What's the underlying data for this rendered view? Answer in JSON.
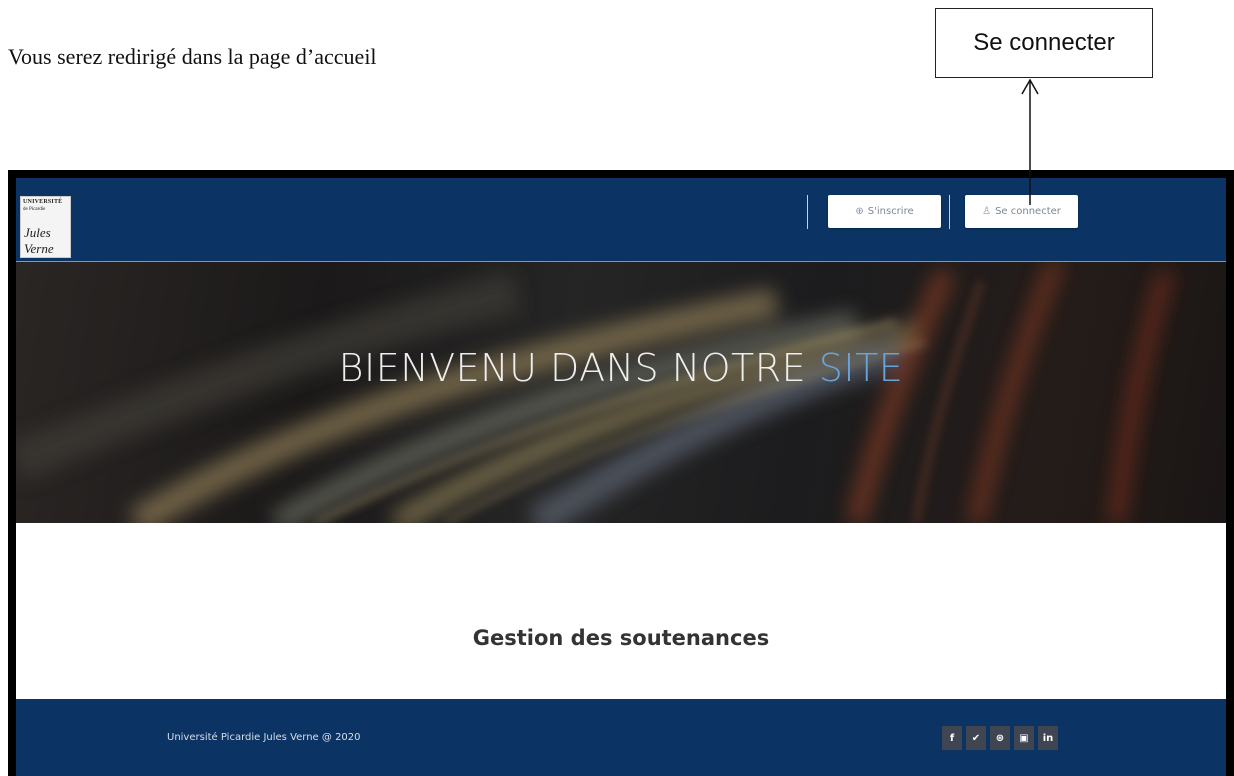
{
  "document": {
    "caption": "Vous serez redirigé dans la page d’accueil",
    "callout_label": "Se connecter"
  },
  "navbar": {
    "logo_text": "UNIVERSITÉ",
    "logo_subtext": "de Picardie",
    "logo_signature": "Jules Verne",
    "signup_label": "S'inscrire",
    "login_label": "Se connecter",
    "signup_icon": "user-plus-icon",
    "login_icon": "user-icon"
  },
  "hero": {
    "title_main": "BIENVENU DANS NOTRE ",
    "title_accent": "SITE"
  },
  "content": {
    "title": "Gestion des soutenances"
  },
  "footer": {
    "copyright": "Université Picardie Jules Verne @ 2020",
    "social": [
      "f",
      "✔",
      "⊛",
      "▣",
      "in"
    ],
    "social_icons": [
      "facebook-icon",
      "twitter-icon",
      "dribbble-icon",
      "flickr-icon",
      "linkedin-icon"
    ]
  },
  "colors": {
    "navbar": "#0b3464",
    "accent": "#6aa3d8",
    "footer": "#0b3464"
  }
}
